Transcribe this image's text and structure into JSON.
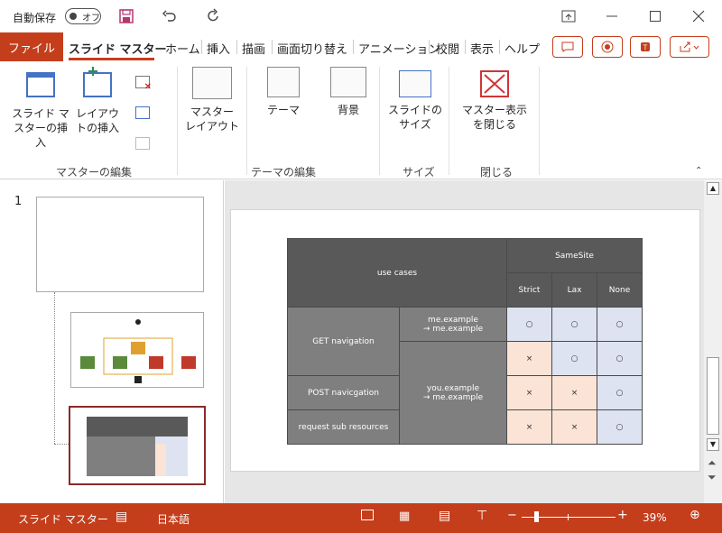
{
  "titlebar": {
    "autosave_label": "自動保存",
    "autosave_state": "オフ"
  },
  "tabs": {
    "file": "ファイル",
    "items": [
      "スライド マスター",
      "ホーム",
      "挿入",
      "描画",
      "画面切り替え",
      "アニメーション",
      "校閲",
      "表示",
      "ヘルプ"
    ],
    "active": "スライド マスター"
  },
  "ribbon": {
    "insert_master": "スライド マスターの挿入",
    "insert_layout": "レイアウトの挿入",
    "group_master_edit": "マスターの編集",
    "master_layout": "マスター\nレイアウト",
    "theme": "テーマ",
    "background": "背景",
    "group_theme_edit": "テーマの編集",
    "slide_size": "スライドの\nサイズ",
    "group_size": "サイズ",
    "close_master": "マスター表示\nを閉じる",
    "group_close": "閉じる"
  },
  "thumbnails": {
    "slide_number": "1"
  },
  "slide_table": {
    "use_cases": "use cases",
    "samesite": "SameSite",
    "cols": [
      "Strict",
      "Lax",
      "None"
    ],
    "rows": {
      "get_nav": "GET navigation",
      "post_nav": "POST navicgation",
      "sub_res": "request sub resources",
      "me_example": "me.example\n→ me.example",
      "you_example": "you.example\n→ me.example"
    },
    "circle": "○",
    "cross": "×"
  },
  "status": {
    "mode": "スライド マスター",
    "language": "日本語",
    "zoom": "39%"
  },
  "colors": {
    "accent": "#c43e1c",
    "header_dark": "#595959",
    "row_grey": "#7f7f7f",
    "cell_blue": "#dde3f0",
    "cell_pink": "#fbe3d6"
  }
}
